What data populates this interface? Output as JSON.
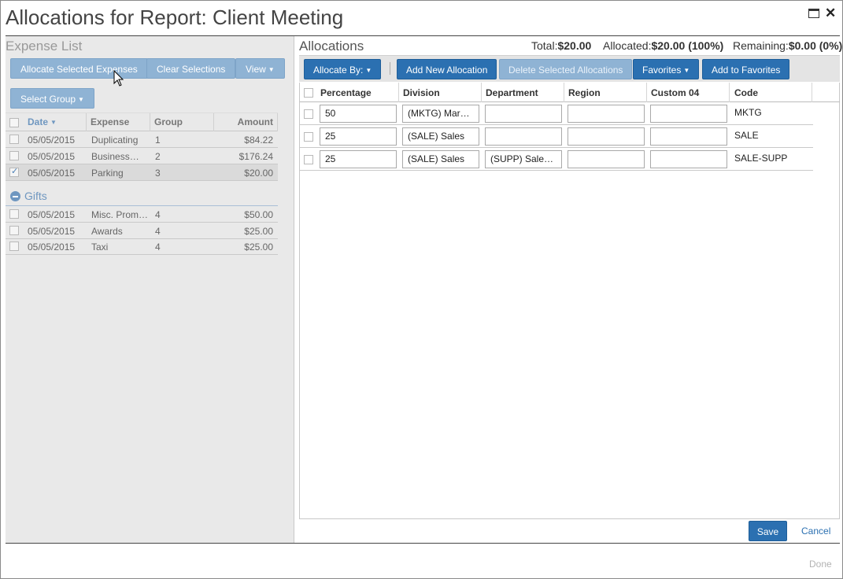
{
  "title": "Allocations for Report: Client Meeting",
  "expense_list": {
    "heading": "Expense List",
    "buttons": {
      "allocate_selected": "Allocate Selected Expenses",
      "clear_selections": "Clear Selections",
      "view": "View",
      "select_group": "Select Group"
    },
    "columns": {
      "date": "Date",
      "expense": "Expense",
      "group": "Group",
      "amount": "Amount"
    },
    "rows": [
      {
        "date": "05/05/2015",
        "expense": "Duplicating",
        "group": "1",
        "amount": "$84.22",
        "checked": false
      },
      {
        "date": "05/05/2015",
        "expense": "Business…",
        "group": "2",
        "amount": "$176.24",
        "checked": false
      },
      {
        "date": "05/05/2015",
        "expense": "Parking",
        "group": "3",
        "amount": "$20.00",
        "checked": true
      }
    ],
    "gifts_group": {
      "label": "Gifts",
      "rows": [
        {
          "date": "05/05/2015",
          "expense": "Misc. Prom…",
          "group": "4",
          "amount": "$50.00"
        },
        {
          "date": "05/05/2015",
          "expense": "Awards",
          "group": "4",
          "amount": "$25.00"
        },
        {
          "date": "05/05/2015",
          "expense": "Taxi",
          "group": "4",
          "amount": "$25.00"
        }
      ]
    }
  },
  "allocations": {
    "heading": "Allocations",
    "totals": {
      "total_label": "Total:",
      "total_value": "$20.00",
      "allocated_label": "Allocated:",
      "allocated_value": "$20.00 (100%)",
      "remaining_label": "Remaining:",
      "remaining_value": "$0.00 (0%)"
    },
    "buttons": {
      "allocate_by": "Allocate By:",
      "add_new": "Add New Allocation",
      "delete_selected": "Delete Selected Allocations",
      "favorites": "Favorites",
      "add_to_favorites": "Add to Favorites"
    },
    "columns": {
      "percentage": "Percentage",
      "division": "Division",
      "department": "Department",
      "region": "Region",
      "custom04": "Custom 04",
      "code": "Code"
    },
    "rows": [
      {
        "percentage": "50",
        "division": "(MKTG) Marketing",
        "department": "",
        "region": "",
        "custom04": "",
        "code": "MKTG"
      },
      {
        "percentage": "25",
        "division": "(SALE) Sales",
        "department": "",
        "region": "",
        "custom04": "",
        "code": "SALE"
      },
      {
        "percentage": "25",
        "division": "(SALE) Sales",
        "department": "(SUPP) Sales Support",
        "region": "",
        "custom04": "",
        "code": "SALE-SUPP"
      }
    ]
  },
  "footer": {
    "save": "Save",
    "cancel": "Cancel",
    "done": "Done"
  }
}
